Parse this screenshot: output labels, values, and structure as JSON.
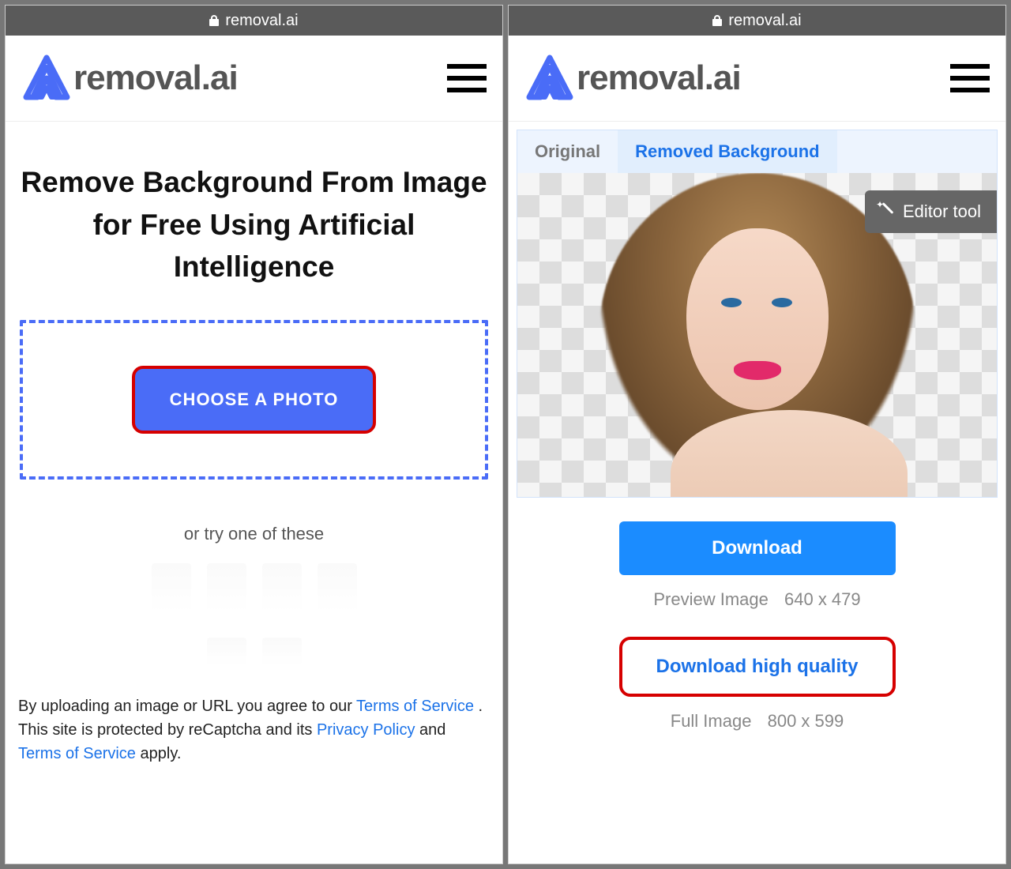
{
  "addressbar": {
    "domain": "removal.ai"
  },
  "brand": {
    "text": "removal.ai"
  },
  "left": {
    "heading": "Remove Background From Image for Free Using Artificial Intelligence",
    "choose_button": "CHOOSE A PHOTO",
    "try_text": "or try one of these",
    "legal_prefix": "By uploading an image or URL you agree to our ",
    "terms1": "Terms of Service",
    "legal_mid1": " . This site is protected by reCaptcha and its ",
    "privacy": "Privacy Policy",
    "legal_mid2": " and ",
    "terms2": "Terms of Service",
    "legal_suffix": " apply."
  },
  "right": {
    "tabs": {
      "original": "Original",
      "removed": "Removed Background"
    },
    "editor_tool": "Editor tool",
    "download": "Download",
    "preview_caption_label": "Preview Image",
    "preview_caption_size": "640 x 479",
    "download_hq": "Download high quality",
    "full_caption_label": "Full Image",
    "full_caption_size": "800 x 599"
  }
}
